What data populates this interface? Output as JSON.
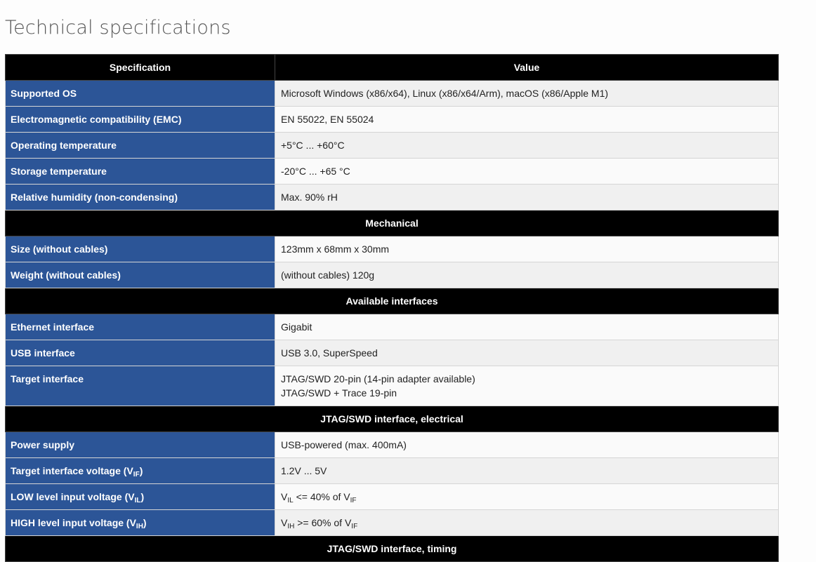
{
  "page": {
    "title": "Technical specifications"
  },
  "table": {
    "headers": {
      "spec": "Specification",
      "value": "Value"
    },
    "general": [
      {
        "key": "Supported OS",
        "value": "Microsoft Windows (x86/x64), Linux (x86/x64/Arm), macOS (x86/Apple M1)"
      },
      {
        "key": "Electromagnetic compatibility (EMC)",
        "value": "EN 55022, EN 55024"
      },
      {
        "key": "Operating temperature",
        "value": "+5°C ... +60°C"
      },
      {
        "key": "Storage temperature",
        "value": "-20°C ... +65 °C"
      },
      {
        "key": "Relative humidity (non-condensing)",
        "value": "Max. 90% rH"
      }
    ],
    "mechanical": {
      "title": "Mechanical",
      "rows": [
        {
          "key": "Size (without cables)",
          "value": "123mm x 68mm x 30mm"
        },
        {
          "key": "Weight (without cables)",
          "value": "(without cables) 120g"
        }
      ]
    },
    "interfaces": {
      "title": "Available interfaces",
      "rows": [
        {
          "key": "Ethernet interface",
          "value": "Gigabit"
        },
        {
          "key": "USB interface",
          "value": "USB 3.0, SuperSpeed"
        },
        {
          "key": "Target interface",
          "value_lines": [
            "JTAG/SWD 20-pin (14-pin adapter available)",
            "JTAG/SWD + Trace 19-pin"
          ]
        }
      ]
    },
    "electrical": {
      "title": "JTAG/SWD interface, electrical",
      "rows": [
        {
          "key": "Power supply",
          "value": "USB-powered (max. 400mA)"
        },
        {
          "key_prefix": "Target interface voltage (V",
          "key_sub": "IF",
          "key_suffix": ")",
          "value": "1.2V ... 5V"
        },
        {
          "key_prefix": "LOW level input voltage (V",
          "key_sub": "IL",
          "key_suffix": ")",
          "v1": "V",
          "v1_sub": "IL",
          "v_mid": " <= 40% of V",
          "v2_sub": "IF"
        },
        {
          "key_prefix": "HIGH level input voltage (V",
          "key_sub": "IH",
          "key_suffix": ")",
          "v1": "V",
          "v1_sub": "IH",
          "v_mid": " >= 60% of V",
          "v2_sub": "IF"
        }
      ]
    },
    "timing": {
      "title": "JTAG/SWD interface, timing"
    }
  }
}
